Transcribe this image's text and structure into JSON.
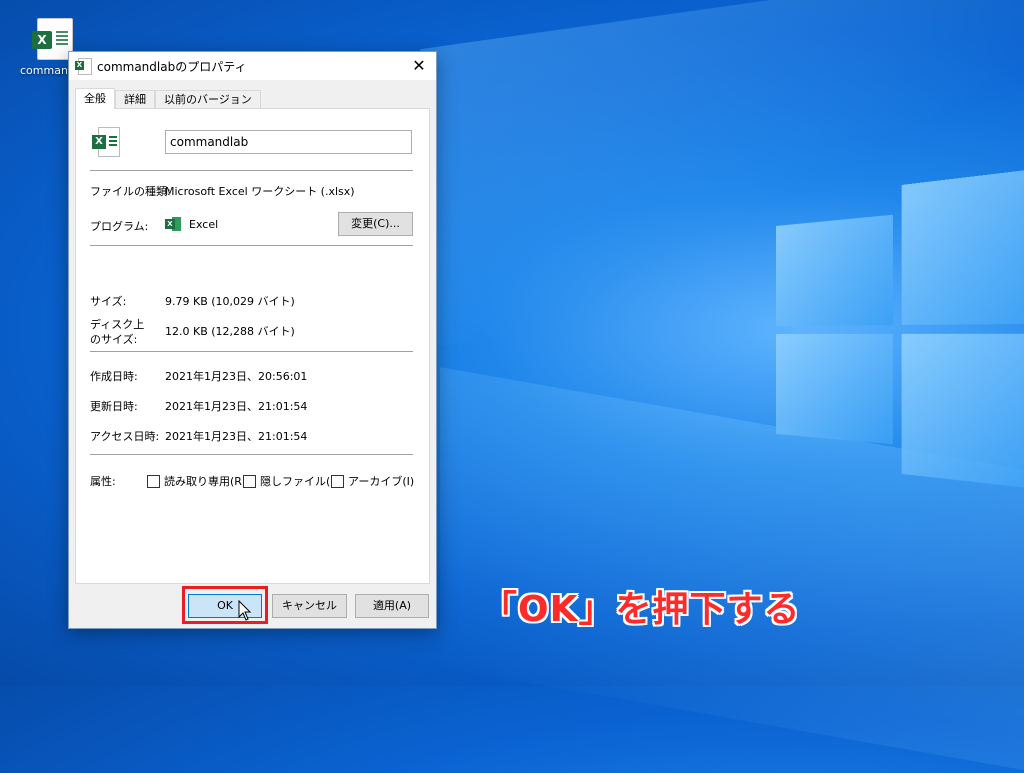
{
  "desktop": {
    "icon_label": "commandlab",
    "instruction": "「OK」を押下する"
  },
  "dialog": {
    "title": "commandlabのプロパティ",
    "tabs": [
      "全般",
      "詳細",
      "以前のバージョン"
    ],
    "file_name": "commandlab",
    "file_type_label": "ファイルの種類:",
    "file_type_value": "Microsoft Excel ワークシート (.xlsx)",
    "program_label": "プログラム:",
    "program_value": "Excel",
    "change_button": "変更(C)...",
    "size_label": "サイズ:",
    "size_value": "9.79 KB (10,029 バイト)",
    "disk_size_label_1": "ディスク上",
    "disk_size_label_2": "のサイズ:",
    "disk_size_value": "12.0 KB (12,288 バイト)",
    "created_label": "作成日時:",
    "created_value": "2021年1月23日、20:56:01",
    "modified_label": "更新日時:",
    "modified_value": "2021年1月23日、21:01:54",
    "accessed_label": "アクセス日時:",
    "accessed_value": "2021年1月23日、21:01:54",
    "attributes_label": "属性:",
    "attributes": [
      "読み取り専用(R)",
      "隠しファイル(H)",
      "アーカイブ(I)"
    ],
    "ok": "OK",
    "cancel": "キャンセル",
    "apply": "適用(A)"
  },
  "colors": {
    "excel_green": "#1d6f42",
    "highlight_red": "#e81e25",
    "instruction_red": "#ff2a2a",
    "ok_focus_blue": "#0078d7"
  }
}
